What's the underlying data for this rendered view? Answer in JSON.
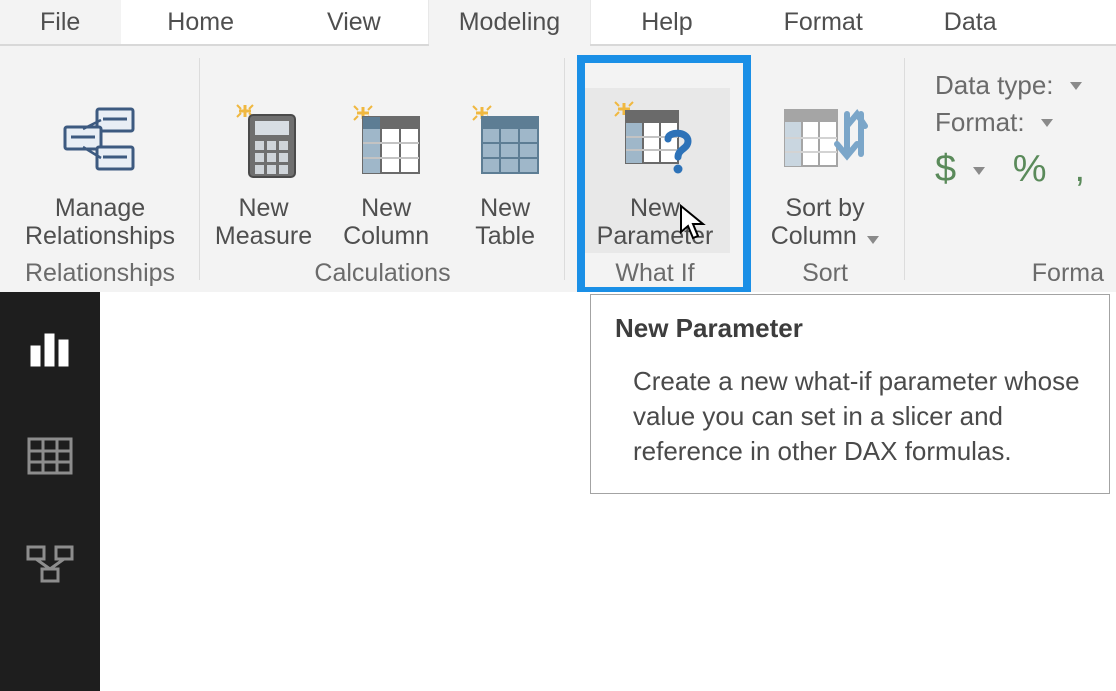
{
  "tabs": {
    "file": "File",
    "home": "Home",
    "view": "View",
    "modeling": "Modeling",
    "help": "Help",
    "format": "Format",
    "data": "Data"
  },
  "ribbon": {
    "relationships": {
      "group_label": "Relationships",
      "manage": {
        "line1": "Manage",
        "line2": "Relationships"
      }
    },
    "calculations": {
      "group_label": "Calculations",
      "new_measure": {
        "line1": "New",
        "line2": "Measure"
      },
      "new_column": {
        "line1": "New",
        "line2": "Column"
      },
      "new_table": {
        "line1": "New",
        "line2": "Table"
      }
    },
    "whatif": {
      "group_label": "What If",
      "new_parameter": {
        "line1": "New",
        "line2": "Parameter"
      }
    },
    "sort": {
      "group_label": "Sort",
      "sort_by_column": {
        "line1": "Sort by",
        "line2": "Column"
      }
    },
    "formatting": {
      "group_label": "Forma",
      "data_type_label": "Data type:",
      "format_label": "Format:",
      "currency_symbol": "$",
      "percent_symbol": "%",
      "comma_symbol": ","
    }
  },
  "tooltip": {
    "title": "New Parameter",
    "body": "Create a new what-if parameter whose value you can set in a slicer and reference in other DAX formulas."
  },
  "sidebar": {
    "report": "report-view",
    "data": "data-view",
    "model": "model-view"
  }
}
